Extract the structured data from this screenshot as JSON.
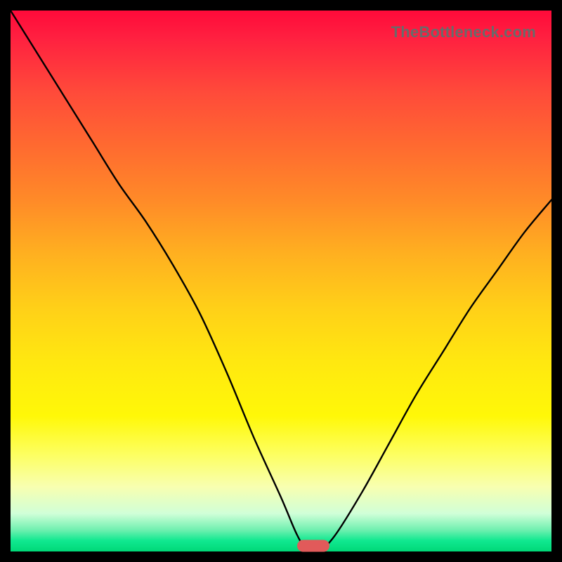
{
  "watermark": "TheBottleneck.com",
  "colors": {
    "frame": "#000000",
    "curve": "#000000",
    "marker": "#e15a5a",
    "gradient_top": "#ff0a3a",
    "gradient_bottom": "#00d878"
  },
  "chart_data": {
    "type": "line",
    "title": "",
    "xlabel": "",
    "ylabel": "",
    "xlim": [
      0,
      100
    ],
    "ylim": [
      0,
      100
    ],
    "series": [
      {
        "name": "bottleneck-curve",
        "x": [
          0,
          5,
          10,
          15,
          20,
          25,
          30,
          35,
          40,
          45,
          50,
          53,
          55,
          57,
          60,
          65,
          70,
          75,
          80,
          85,
          90,
          95,
          100
        ],
        "values": [
          100,
          92,
          84,
          76,
          68,
          61,
          53,
          44,
          33,
          21,
          10,
          3,
          0,
          0,
          3,
          11,
          20,
          29,
          37,
          45,
          52,
          59,
          65
        ]
      }
    ],
    "marker": {
      "x_center": 56,
      "y": 1,
      "width_pct": 6
    },
    "background": "vertical-gradient red→yellow→green"
  }
}
